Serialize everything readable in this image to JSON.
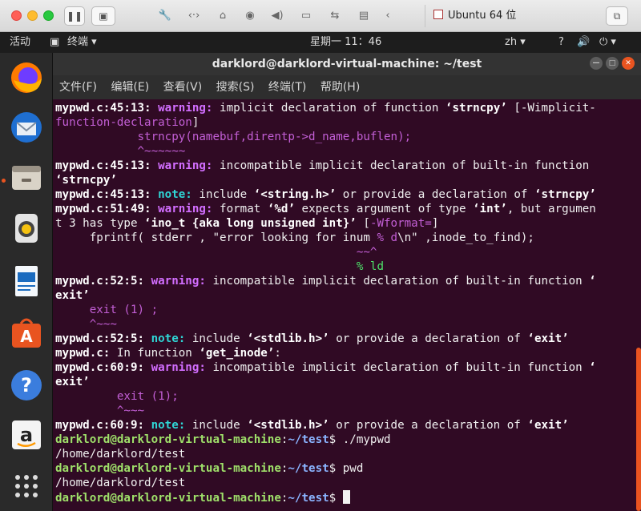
{
  "vm_toolbar": {
    "tab_label": "Ubuntu 64 位"
  },
  "topbar": {
    "activities": "活动",
    "app_menu": "终端 ▾",
    "clock": "星期一 11：46",
    "input_method": "zh ▾",
    "help": "?",
    "volume": "🔊",
    "power": "⏻ ▾"
  },
  "window": {
    "title": "darklord@darklord-virtual-machine: ~/test"
  },
  "menu": {
    "file": "文件(F)",
    "edit": "编辑(E)",
    "view": "查看(V)",
    "search": "搜索(S)",
    "terminal": "终端(T)",
    "help": "帮助(H)"
  },
  "terminal": {
    "loc_45": "mypwd.c:45:13:",
    "loc_51": "mypwd.c:51:49:",
    "loc_52": "mypwd.c:52:5:",
    "loc_file": "mypwd.c:",
    "loc_60": "mypwd.c:60:9:",
    "warning": "warning:",
    "note": "note:",
    "l1_msg": " implicit declaration of function ",
    "fn_strncpy": "‘strncpy’",
    "l1_flag_a": " [-Wimplicit-",
    "l2_flag_b": "function-declaration",
    "l2_bracket": "]",
    "l3_code": "            strncpy(namebuf,direntp->d_name,buflen);",
    "l4_caret": "            ^~~~~~~",
    "incompatible_msg": " incompatible implicit declaration of built-in function",
    "fn_strncpy_noref": "‘strncpy’",
    "include_msg": " include ",
    "hdr_string": "‘<string.h>’",
    "or_provide": " or provide a declaration of ",
    "fn_strncpy_end": "‘strncpy’",
    "format_msg": " format ",
    "fmt_d": "‘%d’",
    "expects_msg": " expects argument of type ",
    "type_int": "‘int’",
    "but_msg": ", but argumen",
    "l9_prefix": "t 3 has type ",
    "type_ino": "‘ino_t {aka long unsigned int}’",
    "l9_flag_open": " [",
    "flag_wformat": "-Wformat=",
    "l9_flag_close": "]",
    "l10_code_a": "     fprintf( stderr , \"error looking for inum ",
    "l10_code_b": "% d",
    "l10_code_c": "\\n\" ,inode_to_find);",
    "l11_tilde": "                                            ~~^",
    "l12_hint": "                                            % ld",
    "fn_open_quote": " ‘",
    "l14_exit": "exit’",
    "l15_code": "     exit (1) ;",
    "l16_caret": "     ^~~~",
    "hdr_stdlib": "‘<stdlib.h>’",
    "fn_exit": "‘exit’",
    "in_function": " In function ",
    "fn_get_inode": "‘get_inode’",
    "colon": ":",
    "l22_code": "         exit (1);",
    "l23_caret": "         ^~~~",
    "prompt_user": "darklord@darklord-virtual-machine",
    "prompt_colon": ":",
    "prompt_path": "~/test",
    "prompt_dollar": "$ ",
    "cmd_1": "./mypwd",
    "out_1": "/home/darklord/test",
    "cmd_2": "pwd",
    "out_2": "/home/darklord/test"
  }
}
